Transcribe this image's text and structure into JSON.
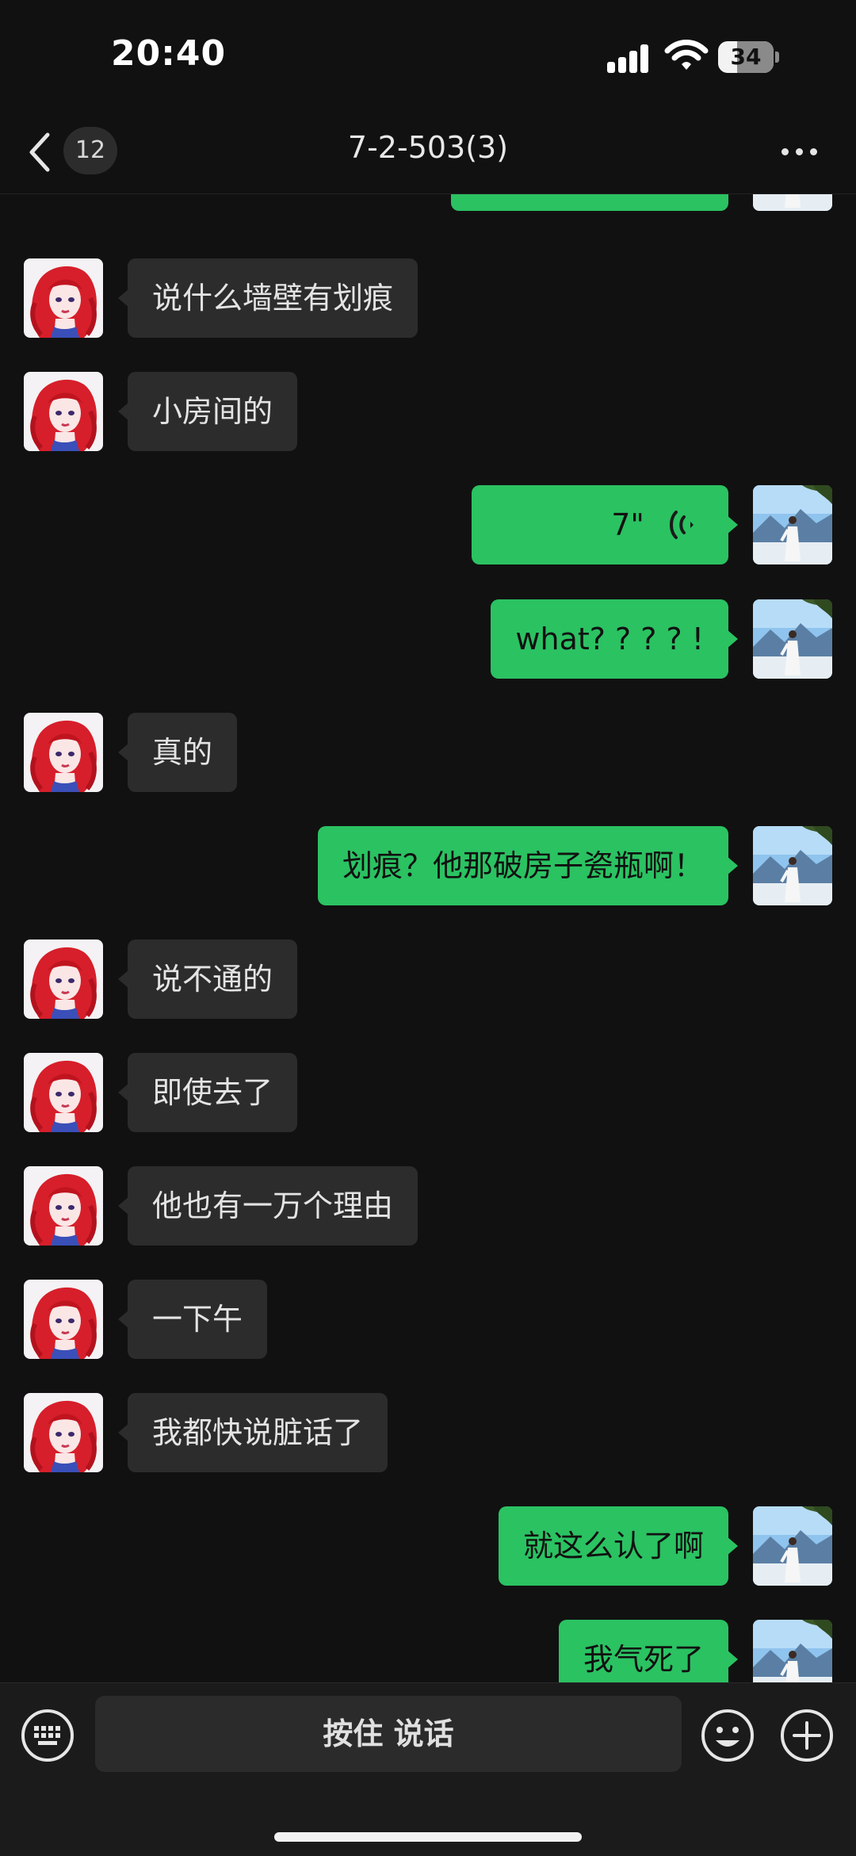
{
  "status_bar": {
    "time": "20:40",
    "battery": "34",
    "battery_level": 0.34
  },
  "header": {
    "back_count": "12",
    "title": "7-2-503(3)"
  },
  "messages": [
    {
      "side": "right",
      "text": ""
    },
    {
      "side": "left",
      "text": "说什么墙壁有划痕"
    },
    {
      "side": "left",
      "text": "小房间的"
    },
    {
      "side": "right",
      "type": "voice",
      "text": "7\""
    },
    {
      "side": "right",
      "text": "what? ? ? ? !"
    },
    {
      "side": "left",
      "text": "真的"
    },
    {
      "side": "right",
      "text": "划痕？他那破房子瓷瓶啊！"
    },
    {
      "side": "left",
      "text": "说不通的"
    },
    {
      "side": "left",
      "text": "即使去了"
    },
    {
      "side": "left",
      "text": "他也有一万个理由"
    },
    {
      "side": "left",
      "text": "一下午"
    },
    {
      "side": "left",
      "text": "我都快说脏话了"
    },
    {
      "side": "right",
      "text": "就这么认了啊"
    },
    {
      "side": "right",
      "text": "我气死了"
    }
  ],
  "input_bar": {
    "hold_to_talk": "按住 说话"
  },
  "colors": {
    "background": "#111111",
    "sent_bubble": "#2bc262",
    "received_bubble": "#2c2c2c",
    "nav_bar": "#111111",
    "input_bar": "#1b1b1b"
  },
  "icons": {
    "keyboard": "keyboard-icon",
    "emoji": "emoji-icon",
    "plus": "plus-icon",
    "back": "chevron-left-icon",
    "more": "more-dots-icon",
    "voice": "voice-wave-icon"
  }
}
